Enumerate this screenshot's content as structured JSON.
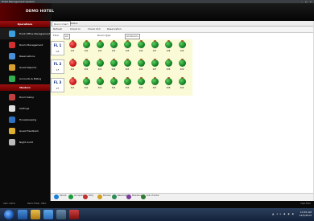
{
  "window": {
    "title": "Hotel Management System",
    "controls": "– □ ×"
  },
  "header": {
    "logo": "DEMO HOTEL"
  },
  "sidebar": {
    "section1": "Operations",
    "items1": [
      {
        "label": "Front Office Management",
        "color": "#3aa0e0",
        "icon": "front-office-icon"
      },
      {
        "label": "Room Management",
        "color": "#d03030",
        "icon": "room-icon"
      },
      {
        "label": "Reservations",
        "color": "#4a90d9",
        "icon": "reservation-icon"
      },
      {
        "label": "Guest Reports",
        "color": "#d9a030",
        "icon": "report-icon"
      },
      {
        "label": "Accounts & Billing",
        "color": "#30b050",
        "icon": "billing-icon"
      }
    ],
    "section2": "Masters",
    "items2": [
      {
        "label": "Room Setup",
        "color": "#c04040",
        "icon": "setup-icon"
      },
      {
        "label": "Settings",
        "color": "#e0e0e0",
        "icon": "settings-icon"
      },
      {
        "label": "Housekeeping",
        "color": "#3070c0",
        "icon": "housekeeping-icon"
      },
      {
        "label": "Guest Feedback",
        "color": "#e0b030",
        "icon": "feedback-icon"
      },
      {
        "label": "Night Audit",
        "color": "#bbbbbb",
        "icon": "audit-icon"
      }
    ]
  },
  "tabs": [
    "Room Chart",
    "Status"
  ],
  "toolbar": {
    "items": [
      "Refresh",
      "Check In",
      "Check Out",
      "Reservation"
    ]
  },
  "filter": {
    "label1": "Floor",
    "value1": "All",
    "label2": "Room Type",
    "value2": "All Rooms"
  },
  "floors": [
    {
      "name": "FL 1",
      "sub": "GF"
    },
    {
      "name": "FL 2",
      "sub": "1F"
    },
    {
      "name": "FL 3",
      "sub": "2F"
    }
  ],
  "rooms": [
    [
      {
        "no": "101",
        "st": "red"
      },
      {
        "no": "102",
        "st": "green"
      },
      {
        "no": "103",
        "st": "green"
      },
      {
        "no": "104",
        "st": "green"
      },
      {
        "no": "105",
        "st": "green"
      },
      {
        "no": "106",
        "st": "green"
      },
      {
        "no": "107",
        "st": "green"
      },
      {
        "no": "108",
        "st": "green"
      },
      {
        "no": "109",
        "st": "green"
      }
    ],
    [
      {
        "no": "201",
        "st": "red"
      },
      {
        "no": "202",
        "st": "green"
      },
      {
        "no": "203",
        "st": "green"
      },
      {
        "no": "204",
        "st": "green"
      },
      {
        "no": "205",
        "st": "green"
      },
      {
        "no": "206",
        "st": "green"
      },
      {
        "no": "207",
        "st": "green"
      },
      {
        "no": "208",
        "st": "green"
      },
      {
        "no": "209",
        "st": "green"
      }
    ],
    [
      {
        "no": "301",
        "st": "red"
      },
      {
        "no": "302",
        "st": "green"
      },
      {
        "no": "303",
        "st": "green"
      },
      {
        "no": "304",
        "st": "green"
      },
      {
        "no": "305",
        "st": "green"
      },
      {
        "no": "306",
        "st": "green"
      },
      {
        "no": "307",
        "st": "green"
      },
      {
        "no": "308",
        "st": "green"
      },
      {
        "no": "309",
        "st": "green"
      }
    ]
  ],
  "legend": [
    {
      "label": "Vacant",
      "color": "#1c7fd8"
    },
    {
      "label": "Occupied",
      "color": "#1a9a3a"
    },
    {
      "label": "Dirty",
      "color": "#c03030"
    },
    {
      "label": "Blocked",
      "color": "#d0a020"
    },
    {
      "label": "Reserved",
      "color": "#2e8b57"
    },
    {
      "label": "Maintenance",
      "color": "#7a3a9a"
    },
    {
      "label": "Out of Order",
      "color": "#2f7a2f"
    }
  ],
  "status": {
    "left": "User: Admin",
    "mid": "Demo Hotel - Main",
    "right": "Caps Num"
  },
  "taskbar": {
    "time": "10:45 AM",
    "date": "12/5/2012",
    "tray": "▲ ◂ ▸ ◆ ◆ ◆"
  }
}
